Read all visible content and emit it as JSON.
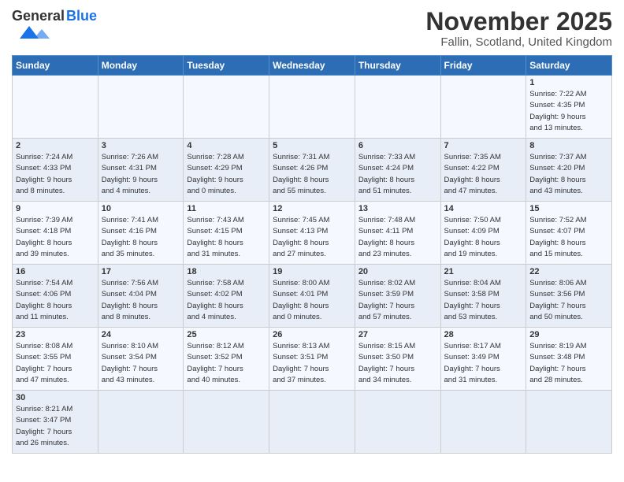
{
  "header": {
    "logo_general": "General",
    "logo_blue": "Blue",
    "month_title": "November 2025",
    "location": "Fallin, Scotland, United Kingdom"
  },
  "weekdays": [
    "Sunday",
    "Monday",
    "Tuesday",
    "Wednesday",
    "Thursday",
    "Friday",
    "Saturday"
  ],
  "weeks": [
    [
      {
        "day": "",
        "info": ""
      },
      {
        "day": "",
        "info": ""
      },
      {
        "day": "",
        "info": ""
      },
      {
        "day": "",
        "info": ""
      },
      {
        "day": "",
        "info": ""
      },
      {
        "day": "",
        "info": ""
      },
      {
        "day": "1",
        "info": "Sunrise: 7:22 AM\nSunset: 4:35 PM\nDaylight: 9 hours\nand 13 minutes."
      }
    ],
    [
      {
        "day": "2",
        "info": "Sunrise: 7:24 AM\nSunset: 4:33 PM\nDaylight: 9 hours\nand 8 minutes."
      },
      {
        "day": "3",
        "info": "Sunrise: 7:26 AM\nSunset: 4:31 PM\nDaylight: 9 hours\nand 4 minutes."
      },
      {
        "day": "4",
        "info": "Sunrise: 7:28 AM\nSunset: 4:29 PM\nDaylight: 9 hours\nand 0 minutes."
      },
      {
        "day": "5",
        "info": "Sunrise: 7:31 AM\nSunset: 4:26 PM\nDaylight: 8 hours\nand 55 minutes."
      },
      {
        "day": "6",
        "info": "Sunrise: 7:33 AM\nSunset: 4:24 PM\nDaylight: 8 hours\nand 51 minutes."
      },
      {
        "day": "7",
        "info": "Sunrise: 7:35 AM\nSunset: 4:22 PM\nDaylight: 8 hours\nand 47 minutes."
      },
      {
        "day": "8",
        "info": "Sunrise: 7:37 AM\nSunset: 4:20 PM\nDaylight: 8 hours\nand 43 minutes."
      }
    ],
    [
      {
        "day": "9",
        "info": "Sunrise: 7:39 AM\nSunset: 4:18 PM\nDaylight: 8 hours\nand 39 minutes."
      },
      {
        "day": "10",
        "info": "Sunrise: 7:41 AM\nSunset: 4:16 PM\nDaylight: 8 hours\nand 35 minutes."
      },
      {
        "day": "11",
        "info": "Sunrise: 7:43 AM\nSunset: 4:15 PM\nDaylight: 8 hours\nand 31 minutes."
      },
      {
        "day": "12",
        "info": "Sunrise: 7:45 AM\nSunset: 4:13 PM\nDaylight: 8 hours\nand 27 minutes."
      },
      {
        "day": "13",
        "info": "Sunrise: 7:48 AM\nSunset: 4:11 PM\nDaylight: 8 hours\nand 23 minutes."
      },
      {
        "day": "14",
        "info": "Sunrise: 7:50 AM\nSunset: 4:09 PM\nDaylight: 8 hours\nand 19 minutes."
      },
      {
        "day": "15",
        "info": "Sunrise: 7:52 AM\nSunset: 4:07 PM\nDaylight: 8 hours\nand 15 minutes."
      }
    ],
    [
      {
        "day": "16",
        "info": "Sunrise: 7:54 AM\nSunset: 4:06 PM\nDaylight: 8 hours\nand 11 minutes."
      },
      {
        "day": "17",
        "info": "Sunrise: 7:56 AM\nSunset: 4:04 PM\nDaylight: 8 hours\nand 8 minutes."
      },
      {
        "day": "18",
        "info": "Sunrise: 7:58 AM\nSunset: 4:02 PM\nDaylight: 8 hours\nand 4 minutes."
      },
      {
        "day": "19",
        "info": "Sunrise: 8:00 AM\nSunset: 4:01 PM\nDaylight: 8 hours\nand 0 minutes."
      },
      {
        "day": "20",
        "info": "Sunrise: 8:02 AM\nSunset: 3:59 PM\nDaylight: 7 hours\nand 57 minutes."
      },
      {
        "day": "21",
        "info": "Sunrise: 8:04 AM\nSunset: 3:58 PM\nDaylight: 7 hours\nand 53 minutes."
      },
      {
        "day": "22",
        "info": "Sunrise: 8:06 AM\nSunset: 3:56 PM\nDaylight: 7 hours\nand 50 minutes."
      }
    ],
    [
      {
        "day": "23",
        "info": "Sunrise: 8:08 AM\nSunset: 3:55 PM\nDaylight: 7 hours\nand 47 minutes."
      },
      {
        "day": "24",
        "info": "Sunrise: 8:10 AM\nSunset: 3:54 PM\nDaylight: 7 hours\nand 43 minutes."
      },
      {
        "day": "25",
        "info": "Sunrise: 8:12 AM\nSunset: 3:52 PM\nDaylight: 7 hours\nand 40 minutes."
      },
      {
        "day": "26",
        "info": "Sunrise: 8:13 AM\nSunset: 3:51 PM\nDaylight: 7 hours\nand 37 minutes."
      },
      {
        "day": "27",
        "info": "Sunrise: 8:15 AM\nSunset: 3:50 PM\nDaylight: 7 hours\nand 34 minutes."
      },
      {
        "day": "28",
        "info": "Sunrise: 8:17 AM\nSunset: 3:49 PM\nDaylight: 7 hours\nand 31 minutes."
      },
      {
        "day": "29",
        "info": "Sunrise: 8:19 AM\nSunset: 3:48 PM\nDaylight: 7 hours\nand 28 minutes."
      }
    ],
    [
      {
        "day": "30",
        "info": "Sunrise: 8:21 AM\nSunset: 3:47 PM\nDaylight: 7 hours\nand 26 minutes."
      },
      {
        "day": "",
        "info": ""
      },
      {
        "day": "",
        "info": ""
      },
      {
        "day": "",
        "info": ""
      },
      {
        "day": "",
        "info": ""
      },
      {
        "day": "",
        "info": ""
      },
      {
        "day": "",
        "info": ""
      }
    ]
  ]
}
